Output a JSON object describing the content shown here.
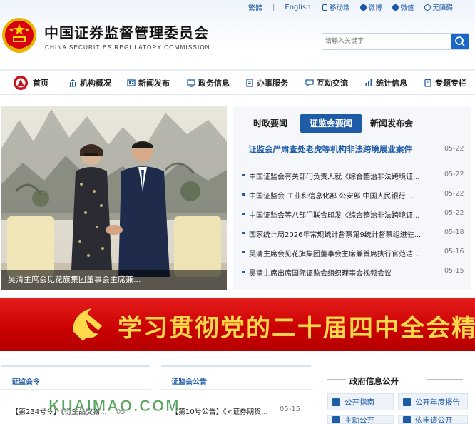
{
  "header": {
    "title_cn": "中国证券监督管理委员会",
    "title_en": "CHINA SECURITIES REGULATORY COMMISSION",
    "top_links": [
      "繁體",
      "English"
    ],
    "top_icons": [
      "移动端",
      "微博",
      "微信",
      "无障碍"
    ],
    "search_placeholder": "请输入关键字"
  },
  "nav": {
    "items": [
      "首页",
      "机构概况",
      "新闻发布",
      "政务信息",
      "办事服务",
      "互动交流",
      "统计信息",
      "专题专栏"
    ]
  },
  "slideshow": {
    "caption": "吴清主席会见花旗集团董事会主席兼..."
  },
  "news": {
    "tabs": [
      "时政要闻",
      "证监会要闻",
      "新闻发布会"
    ],
    "active_tab": "证监会要闻",
    "headline": "证监会严肃查处老虎等机构非法跨境展业案件",
    "headline_date": "05-22",
    "items": [
      {
        "title": "中国证监会有关部门负责人就《综合整治非法跨境证...",
        "date": "05-22"
      },
      {
        "title": "中国证监会 工业和信息化部 公安部 中国人民银行 ...",
        "date": "05-22"
      },
      {
        "title": "中国证监会等八部门联合印发《综合整治非法跨境证...",
        "date": "05-22"
      },
      {
        "title": "国家统计局2026年常规统计督察第9统计督察组进驻...",
        "date": "05-18"
      },
      {
        "title": "吴清主席会见花旗集团董事会主席兼首席执行官范洁...",
        "date": "05-16"
      },
      {
        "title": "吴清主席出席国际证监会组织理事会视频会议",
        "date": "05-15"
      }
    ]
  },
  "banner": {
    "text": "学习贯彻党的二十届四中全会精"
  },
  "columns": {
    "orders": {
      "title": "证监会令",
      "first_item": "【第234号令】《衍生品交易...",
      "first_date": "05"
    },
    "announcements": {
      "title": "证监会公告",
      "first_item": "【第10号公告】《<证券期货...",
      "first_date": "05-15"
    }
  },
  "gov_info": {
    "title": "政府信息公开",
    "buttons": [
      "公开指南",
      "公开年度报告",
      "主动公开",
      "依申请公开"
    ]
  },
  "watermark": "KUAIMAO.COM",
  "colors": {
    "primary_blue": "#1f5ca8",
    "banner_red": "#c80000",
    "banner_text": "#ffd94a"
  }
}
